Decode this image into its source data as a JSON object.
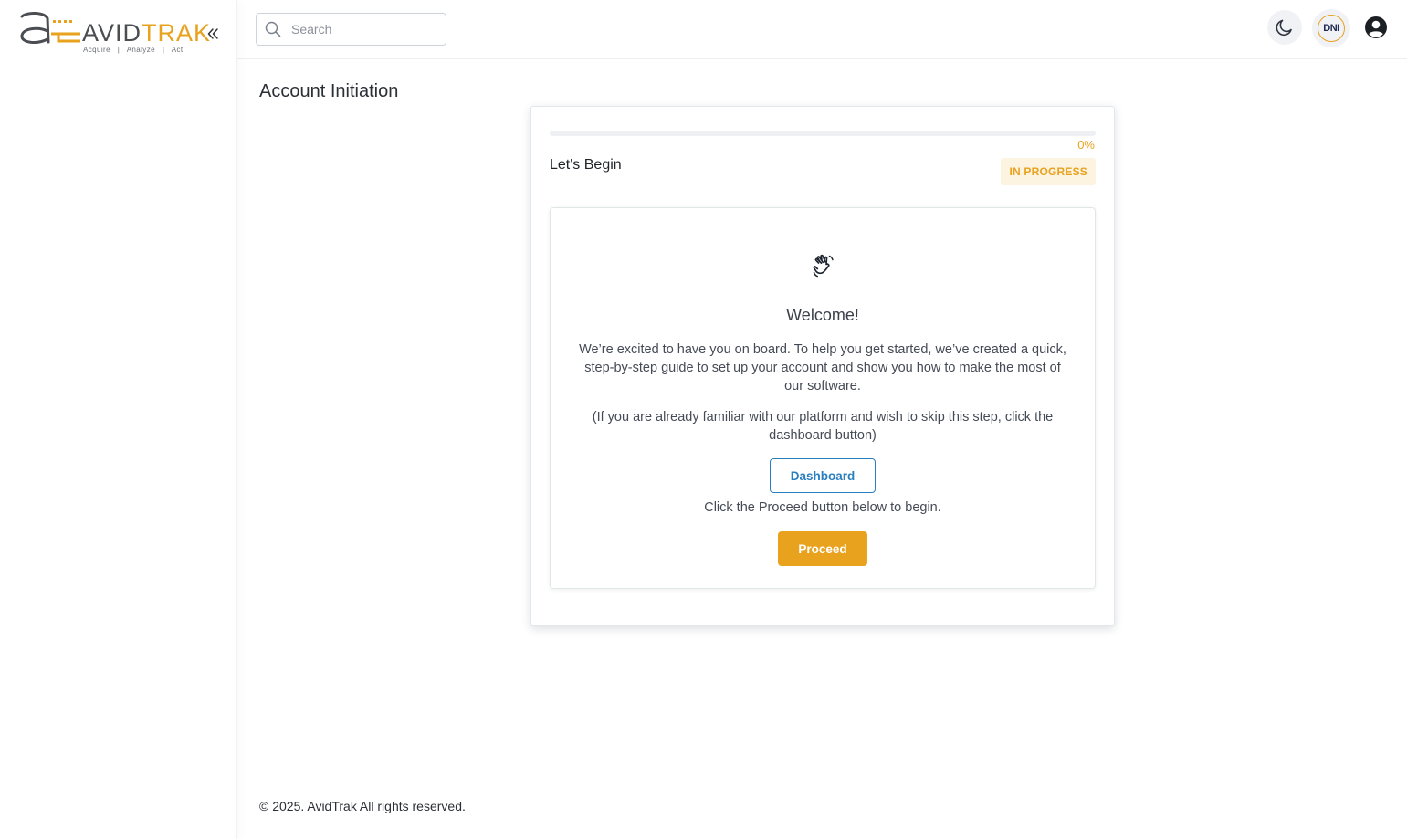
{
  "brand": {
    "name_part1": "AVID",
    "name_part2": "TRAK",
    "tagline": "Acquire   |   Analyze   |   Act",
    "colors": {
      "primary": "#e8a21e",
      "secondary": "#4a4d52",
      "link": "#2a7fc0"
    }
  },
  "sidebar": {
    "collapse_icon": "double-chevron-left-icon"
  },
  "header": {
    "search_placeholder": "Search",
    "search_value": "",
    "theme_icon": "moon-icon",
    "org_badge": "DNI",
    "user_icon": "user-circle-icon"
  },
  "page": {
    "title": "Account Initiation"
  },
  "onboarding": {
    "progress_value": 0,
    "progress_label": "0%",
    "step_title": "Let's Begin",
    "status": "IN PROGRESS",
    "icon": "waving-hand-icon",
    "heading": "Welcome!",
    "intro": "We’re excited to have you on board. To help you get started, we’ve created a quick, step-by-step guide to set up your account and show you how to make the most of our software.",
    "skip_note": "(If you are already familiar with our platform and wish to skip this step, click the dashboard button)",
    "dashboard_label": "Dashboard",
    "proceed_hint": "Click the Proceed button below to begin.",
    "proceed_label": "Proceed"
  },
  "footer": {
    "copyright": "© 2025. AvidTrak All rights reserved."
  }
}
